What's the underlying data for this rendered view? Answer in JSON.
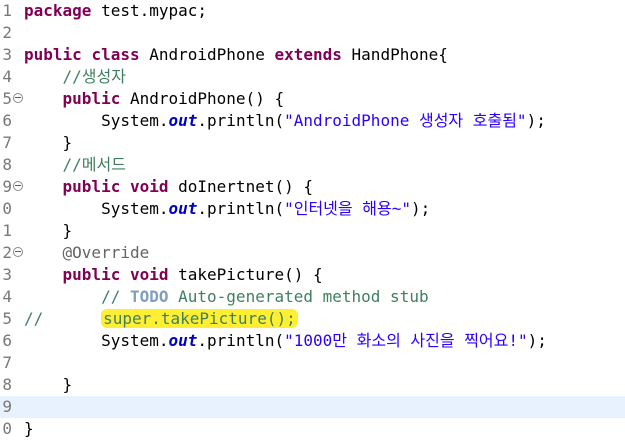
{
  "editor": {
    "lines": [
      {
        "num": "1",
        "fold": false,
        "tokens": [
          {
            "c": "kw",
            "t": "package"
          },
          {
            "c": "",
            "t": " test.mypac;"
          }
        ]
      },
      {
        "num": "2",
        "fold": false,
        "tokens": []
      },
      {
        "num": "3",
        "fold": false,
        "tokens": [
          {
            "c": "kw",
            "t": "public"
          },
          {
            "c": "",
            "t": " "
          },
          {
            "c": "kw",
            "t": "class"
          },
          {
            "c": "",
            "t": " AndroidPhone "
          },
          {
            "c": "kw",
            "t": "extends"
          },
          {
            "c": "",
            "t": " HandPhone{"
          }
        ]
      },
      {
        "num": "4",
        "fold": false,
        "tokens": [
          {
            "c": "",
            "t": "    "
          },
          {
            "c": "cmt",
            "t": "//생성자"
          }
        ]
      },
      {
        "num": "5",
        "fold": true,
        "tokens": [
          {
            "c": "",
            "t": "    "
          },
          {
            "c": "kw",
            "t": "public"
          },
          {
            "c": "",
            "t": " AndroidPhone() {"
          }
        ]
      },
      {
        "num": "6",
        "fold": false,
        "tokens": [
          {
            "c": "",
            "t": "        System."
          },
          {
            "c": "fld",
            "t": "out"
          },
          {
            "c": "",
            "t": ".println("
          },
          {
            "c": "str",
            "t": "\"AndroidPhone 생성자 호출됨\""
          },
          {
            "c": "",
            "t": ");"
          }
        ]
      },
      {
        "num": "7",
        "fold": false,
        "tokens": [
          {
            "c": "",
            "t": "    }"
          }
        ]
      },
      {
        "num": "8",
        "fold": false,
        "tokens": [
          {
            "c": "",
            "t": "    "
          },
          {
            "c": "cmt",
            "t": "//메서드"
          }
        ]
      },
      {
        "num": "9",
        "fold": true,
        "tokens": [
          {
            "c": "",
            "t": "    "
          },
          {
            "c": "kw",
            "t": "public"
          },
          {
            "c": "",
            "t": " "
          },
          {
            "c": "kw",
            "t": "void"
          },
          {
            "c": "",
            "t": " doInertnet() {"
          }
        ]
      },
      {
        "num": "0",
        "fold": false,
        "tokens": [
          {
            "c": "",
            "t": "        System."
          },
          {
            "c": "fld",
            "t": "out"
          },
          {
            "c": "",
            "t": ".println("
          },
          {
            "c": "str",
            "t": "\"인터넷을 해용~\""
          },
          {
            "c": "",
            "t": ");"
          }
        ]
      },
      {
        "num": "1",
        "fold": false,
        "tokens": [
          {
            "c": "",
            "t": "    }"
          }
        ]
      },
      {
        "num": "2",
        "fold": true,
        "tokens": [
          {
            "c": "",
            "t": "    "
          },
          {
            "c": "ann",
            "t": "@Override"
          }
        ]
      },
      {
        "num": "3",
        "fold": false,
        "tokens": [
          {
            "c": "",
            "t": "    "
          },
          {
            "c": "kw",
            "t": "public"
          },
          {
            "c": "",
            "t": " "
          },
          {
            "c": "kw",
            "t": "void"
          },
          {
            "c": "",
            "t": " takePicture() {"
          }
        ]
      },
      {
        "num": "4",
        "fold": false,
        "tokens": [
          {
            "c": "",
            "t": "        "
          },
          {
            "c": "cmt",
            "t": "// "
          },
          {
            "c": "todo",
            "t": "TODO"
          },
          {
            "c": "cmt",
            "t": " Auto-generated method stub"
          }
        ]
      },
      {
        "num": "5",
        "fold": false,
        "tokens": [
          {
            "c": "cmt",
            "t": "//      "
          },
          {
            "c": "cmt hl",
            "t": "super.takePicture();"
          }
        ]
      },
      {
        "num": "6",
        "fold": false,
        "tokens": [
          {
            "c": "",
            "t": "        System."
          },
          {
            "c": "fld",
            "t": "out"
          },
          {
            "c": "",
            "t": ".println("
          },
          {
            "c": "str",
            "t": "\"1000만 화소의 사진을 찍어요!\""
          },
          {
            "c": "",
            "t": ");"
          }
        ]
      },
      {
        "num": "7",
        "fold": false,
        "tokens": []
      },
      {
        "num": "8",
        "fold": false,
        "tokens": [
          {
            "c": "",
            "t": "    }"
          }
        ]
      },
      {
        "num": "9",
        "fold": false,
        "current": true,
        "tokens": []
      },
      {
        "num": "0",
        "fold": false,
        "tokens": [
          {
            "c": "",
            "t": "}"
          }
        ]
      }
    ]
  }
}
